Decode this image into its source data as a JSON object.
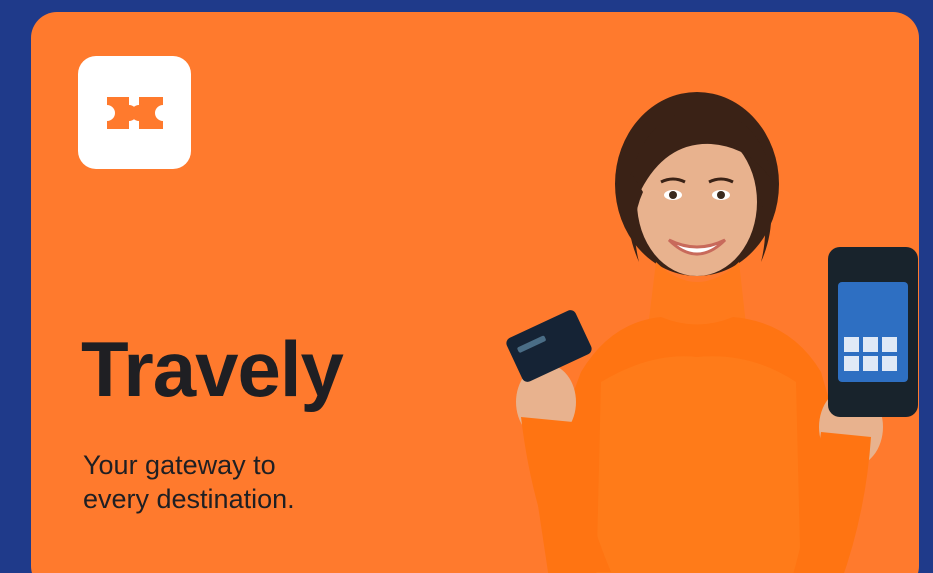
{
  "brand": {
    "name": "Travely",
    "tagline_line1": "Your gateway to",
    "tagline_line2": "every destination.",
    "logo_icon": "ticket-icon"
  },
  "colors": {
    "background": "#1f3a8a",
    "card": "#ff7a2d",
    "text": "#1f1f23",
    "logo_tile": "#ffffff"
  },
  "hero": {
    "icon": "person-holding-card-and-terminal"
  }
}
